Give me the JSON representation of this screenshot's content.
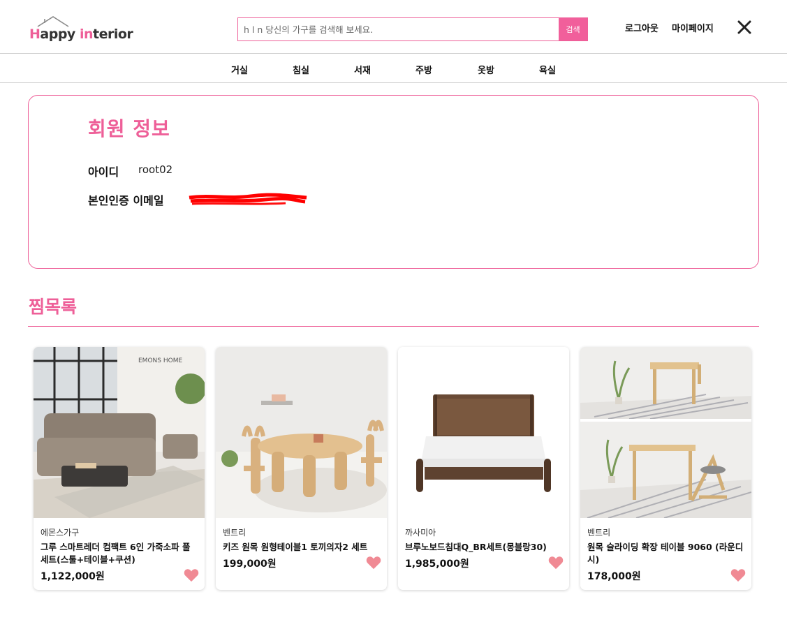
{
  "header": {
    "logo": {
      "first": "H",
      "word1": "appy ",
      "i": "in",
      "word2": "terior"
    },
    "search": {
      "placeholder": "h l n 당신의 가구를 검색해 보세요.",
      "button_label": "검색"
    },
    "logout_label": "로그아웃",
    "mypage_label": "마이페이지",
    "icons": {
      "close": "close-icon",
      "logo": "house-roof-icon"
    }
  },
  "nav": {
    "items": [
      {
        "label": "거실"
      },
      {
        "label": "침실"
      },
      {
        "label": "서재"
      },
      {
        "label": "주방"
      },
      {
        "label": "옷방"
      },
      {
        "label": "욕실"
      }
    ]
  },
  "member": {
    "title": "회원 정보",
    "id_label": "아이디",
    "id_value": "root02",
    "email_label": "본인인증 이메일"
  },
  "wishlist": {
    "title": "찜목록",
    "items": [
      {
        "brand": "에몬스가구",
        "name": "그루 스마트레더 컴팩트 6인 가죽소파 풀세트(스툴+테이블+쿠션)",
        "price": "1,122,000원",
        "image_label": "EMONS HOME"
      },
      {
        "brand": "벤트리",
        "name": "키즈 원목 원형테이블1 토끼의자2 세트",
        "price": "199,000원"
      },
      {
        "brand": "까사미아",
        "name": "브루노보드침대Q_BR세트(몽블랑30)",
        "price": "1,985,000원"
      },
      {
        "brand": "벤트리",
        "name": "원목 슬라이딩 확장 테이블 9060 (라운디시)",
        "price": "178,000원"
      }
    ]
  },
  "colors": {
    "accent": "#ee5f98",
    "heart": "#f08a94",
    "redaction": "#ff0000"
  }
}
